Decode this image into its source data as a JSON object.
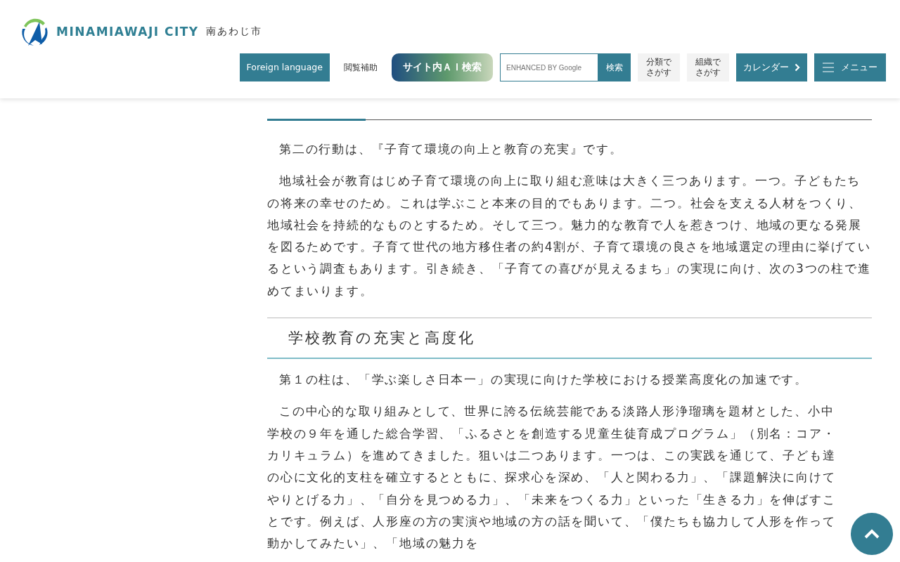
{
  "header": {
    "logo_text": "MINAMIAWAJI CITY",
    "logo_subtext": "南あわじ市",
    "nav": [
      {
        "kind": "teal",
        "label": "Foreign language"
      },
      {
        "kind": "plain",
        "label": "閲覧補助"
      },
      {
        "kind": "ai",
        "label": "サイト内ＡＩ検索"
      },
      {
        "kind": "search",
        "placeholder": "ENHANCED BY Google",
        "label": "検索"
      },
      {
        "kind": "grey",
        "label": "分類でさがす"
      },
      {
        "kind": "grey",
        "label": "組織でさがす"
      },
      {
        "kind": "calendar",
        "label": "カレンダー"
      },
      {
        "kind": "menu",
        "label": "メニュー"
      }
    ]
  },
  "sections": [
    {
      "kind": "h2",
      "paragraphs": [
        "第二の行動は、『子育て環境の向上と教育の充実』です。",
        "地域社会が教育はじめ子育て環境の向上に取り組む意味は大きく三つあります。一つ。子どもたちの将来の幸せのため。これは学ぶこと本来の目的でもあります。二つ。社会を支える人材をつくり、地域社会を持続的なものとするため。そして三つ。魅力的な教育で人を惹きつけ、地域の更なる発展を図るためです。子育て世代の地方移住者の約4割が、子育て環境の良さを地域選定の理由に挙げているという調査もあります。引き続き、「子育ての喜びが見えるまち」の実現に向け、次の3つの柱で進めてまいります。"
      ]
    },
    {
      "kind": "h3",
      "heading": "学校教育の充実と高度化",
      "paragraphs": [
        "第１の柱は、「学ぶ楽しさ日本一」の実現に向けた学校における授業高度化の加速です。",
        "この中心的な取り組みとして、世界に誇る伝統芸能である淡路人形浄瑠璃を題材とした、小中学校の９年を通した総合学習、「ふるさとを創造する児童生徒育成プログラム」（別名：コア・カリキュラム）を進めてきました。狙いは二つあります。一つは、この実践を通じて、子ども達の心に文化的支柱を確立するとともに、探求心を深め、「人と関わる力」、「課題解決に向けてやりとげる力」、「自分を見つめる力」、「未来をつくる力」といった「生きる力」を伸ばすことです。例えば、人形座の方の実演や地域の方の話を聞いて、「僕たちも協力して人形を作って動かしてみたい」、「地域の魅力を"
      ]
    }
  ]
}
